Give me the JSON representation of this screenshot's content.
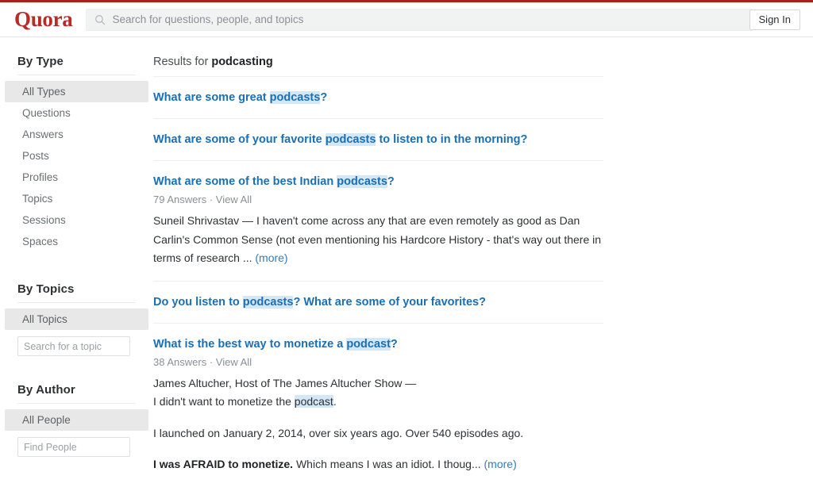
{
  "brand": {
    "logo_text": "Quora",
    "logo_color": "#b92b27",
    "accent_link_color": "#1a6fb5",
    "highlight_color": "#d3e7f7"
  },
  "header": {
    "search_placeholder": "Search for questions, people, and topics",
    "search_value": "",
    "search_icon": "search-icon",
    "sign_in_label": "Sign In"
  },
  "sidebar": {
    "sections": [
      {
        "heading": "By Type",
        "items": [
          {
            "label": "All Types",
            "active": true
          },
          {
            "label": "Questions",
            "active": false
          },
          {
            "label": "Answers",
            "active": false
          },
          {
            "label": "Posts",
            "active": false
          },
          {
            "label": "Profiles",
            "active": false
          },
          {
            "label": "Topics",
            "active": false
          },
          {
            "label": "Sessions",
            "active": false
          },
          {
            "label": "Spaces",
            "active": false
          }
        ]
      },
      {
        "heading": "By Topics",
        "items": [
          {
            "label": "All Topics",
            "active": true
          }
        ],
        "input": {
          "placeholder": "Search for a topic",
          "value": ""
        }
      },
      {
        "heading": "By Author",
        "items": [
          {
            "label": "All People",
            "active": true
          }
        ],
        "input": {
          "placeholder": "Find People",
          "value": ""
        }
      }
    ]
  },
  "main": {
    "results_for_prefix": "Results for",
    "query": "podcasting",
    "results": [
      {
        "title_parts": [
          {
            "text": "What are some great ",
            "highlight": false
          },
          {
            "text": "podcasts",
            "highlight": true
          },
          {
            "text": "?",
            "highlight": false
          }
        ]
      },
      {
        "title_parts": [
          {
            "text": "What are some of your favorite ",
            "highlight": false
          },
          {
            "text": "podcasts",
            "highlight": true
          },
          {
            "text": " to listen to in the morning?",
            "highlight": false
          }
        ]
      },
      {
        "title_parts": [
          {
            "text": "What are some of the best Indian ",
            "highlight": false
          },
          {
            "text": "podcasts",
            "highlight": true
          },
          {
            "text": "?",
            "highlight": false
          }
        ],
        "answers_count": "79 Answers",
        "meta_separator": "·",
        "view_all": "View All",
        "snippet_author": "Suneil Shrivastav",
        "snippet_text": " — I haven't come across any that are even remotely as good as Dan Carlin's Common Sense (not even mentioning his Hardcore History - that's way out there in terms of research ... ",
        "more_label": "(more)"
      },
      {
        "title_parts": [
          {
            "text": "Do you listen to ",
            "highlight": false
          },
          {
            "text": "podcasts",
            "highlight": true
          },
          {
            "text": "? What are some of your favorites?",
            "highlight": false
          }
        ]
      },
      {
        "title_parts": [
          {
            "text": "What is the best way to monetize a ",
            "highlight": false
          },
          {
            "text": "podcast",
            "highlight": true
          },
          {
            "text": "?",
            "highlight": false
          }
        ],
        "answers_count": "38 Answers",
        "meta_separator": "·",
        "view_all": "View All",
        "snippet_byline": "James Altucher, Host of The James Altucher Show —",
        "snippet_line2_pre": "I didn't want to monetize the ",
        "snippet_line2_hl": "podcast",
        "snippet_line2_post": ".",
        "snippet_para2": "I launched on January 2, 2014, over six years ago. Over 540 episodes ago.",
        "snippet_para3_bold": "I was AFRAID to monetize.",
        "snippet_para3_rest": " Which means I was an idiot. I thoug... ",
        "more_label": "(more)"
      }
    ]
  }
}
